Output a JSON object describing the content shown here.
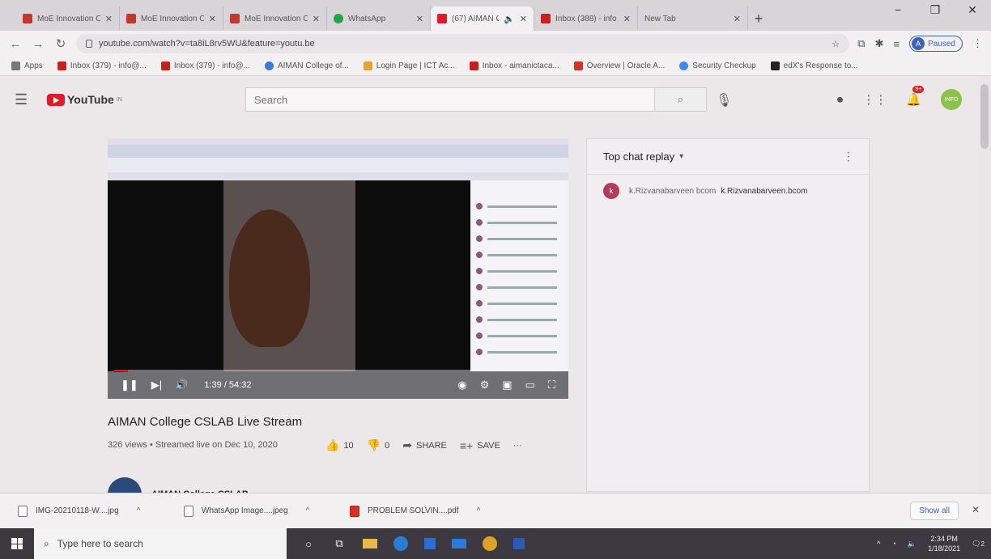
{
  "browser": {
    "tabs": [
      {
        "title": "MoE Innovation Ce",
        "color": "#c0392b"
      },
      {
        "title": "MoE Innovation Ce",
        "color": "#c0392b"
      },
      {
        "title": "MoE Innovation Ce",
        "color": "#c0392b"
      },
      {
        "title": "WhatsApp",
        "color": "#25a34a"
      },
      {
        "title": "(67) AIMAN C",
        "color": "#e01c2a"
      },
      {
        "title": "Inbox (388) - info",
        "color": "#c5221f"
      },
      {
        "title": "New Tab",
        "color": ""
      }
    ],
    "url": "youtube.com/watch?v=ta8iL8rv5WU&feature=youtu.be",
    "profile_initial": "A",
    "profile_status": "Paused",
    "bookmarks": [
      {
        "label": "Apps",
        "color": "#777777"
      },
      {
        "label": "Inbox (379) - info@...",
        "color": "#c5221f"
      },
      {
        "label": "Inbox (379) - info@...",
        "color": "#c5221f"
      },
      {
        "label": "AIMAN College of...",
        "color": "#3a7bd5"
      },
      {
        "label": "Login Page | ICT Ac...",
        "color": "#e8a42a"
      },
      {
        "label": "Inbox - aimanictaca...",
        "color": "#c5221f"
      },
      {
        "label": "Overview | Oracle A...",
        "color": "#d93025"
      },
      {
        "label": "Security Checkup",
        "color": "#4285f4"
      },
      {
        "label": "edX's Response to...",
        "color": "#222222"
      }
    ]
  },
  "youtube": {
    "logo_text": "YouTube",
    "logo_region": "IN",
    "search_placeholder": "Search",
    "notifications_badge": "9+",
    "user_avatar_text": "INFO"
  },
  "video": {
    "current_time": "1:39 / 54:32",
    "progress": 0.03,
    "title": "AIMAN College CSLAB Live Stream",
    "meta": "326 views • Streamed live on Dec 10, 2020",
    "likes": "10",
    "dislikes": "0",
    "share_label": "SHARE",
    "save_label": "SAVE",
    "channel_name": "AIMAN College CSLAB"
  },
  "chat": {
    "header": "Top chat replay",
    "messages": [
      {
        "initial": "k",
        "author": "k.Rizvanabarveen bcom",
        "text": "k.Rizvanabarveen.bcom"
      }
    ]
  },
  "downloads": {
    "items": [
      {
        "name": "IMG-20210118-W....jpg",
        "type": "img"
      },
      {
        "name": "WhatsApp Image....jpeg",
        "type": "img"
      },
      {
        "name": "PROBLEM SOLVIN....pdf",
        "type": "pdf"
      }
    ],
    "show_all": "Show all"
  },
  "taskbar": {
    "search_placeholder": "Type here to search",
    "time": "2:34 PM",
    "date": "1/18/2021",
    "notification_count": "2"
  }
}
